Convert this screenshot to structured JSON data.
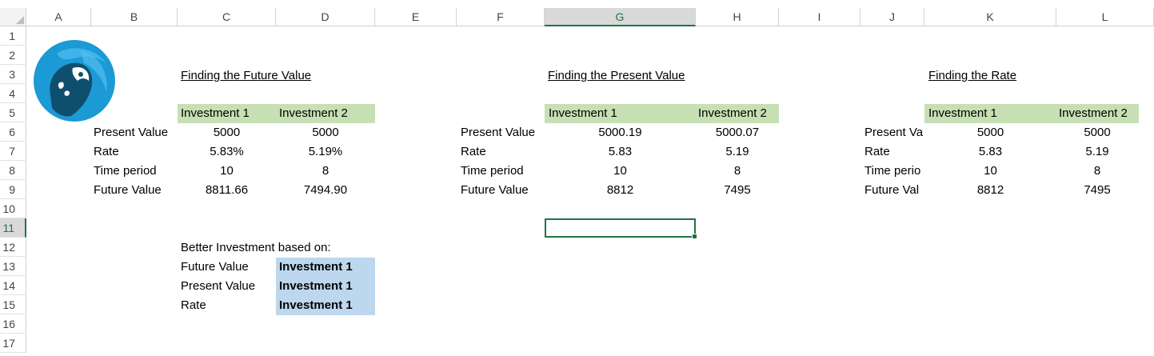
{
  "columns": [
    "A",
    "B",
    "C",
    "D",
    "E",
    "F",
    "G",
    "H",
    "I",
    "J",
    "K",
    "L"
  ],
  "rows": [
    "1",
    "2",
    "3",
    "4",
    "5",
    "6",
    "7",
    "8",
    "9",
    "10",
    "11",
    "12",
    "13",
    "14",
    "15",
    "16",
    "17"
  ],
  "selected_column": "G",
  "selected_row": "11",
  "logo": {
    "icon": "parrot-logo-icon",
    "colors": {
      "bg": "#1b9ad6",
      "dark": "#0f4f6e"
    }
  },
  "future_value": {
    "title": "Finding the Future Value",
    "headers": [
      "Investment 1",
      "Investment 2"
    ],
    "labels": [
      "Present Value",
      "Rate",
      "Time period",
      "Future Value"
    ],
    "inv1": [
      "5000",
      "5.83%",
      "10",
      "8811.66"
    ],
    "inv2": [
      "5000",
      "5.19%",
      "8",
      "7494.90"
    ]
  },
  "present_value": {
    "title": "Finding the Present Value",
    "headers": [
      "Investment 1",
      "Investment 2"
    ],
    "labels": [
      "Present Value",
      "Rate",
      "Time period",
      "Future Value"
    ],
    "inv1": [
      "5000.19",
      "5.83",
      "10",
      "8812"
    ],
    "inv2": [
      "5000.07",
      "5.19",
      "8",
      "7495"
    ]
  },
  "rate": {
    "title": "Finding the Rate",
    "headers": [
      "Investment 1",
      "Investment 2"
    ],
    "labels": [
      "Present Va",
      "Rate",
      "Time perio",
      "Future Val"
    ],
    "inv1": [
      "5000",
      "5.83",
      "10",
      "8812"
    ],
    "inv2": [
      "5000",
      "5.19",
      "8",
      "7495"
    ]
  },
  "better": {
    "title": "Better Investment based on:",
    "labels": [
      "Future Value",
      "Present Value",
      "Rate"
    ],
    "results": [
      "Investment 1",
      "Investment 1",
      "Investment 1"
    ]
  },
  "colors": {
    "green_header": "#c6e0b4",
    "blue_result": "#bdd7ee",
    "excel_green": "#217346"
  }
}
